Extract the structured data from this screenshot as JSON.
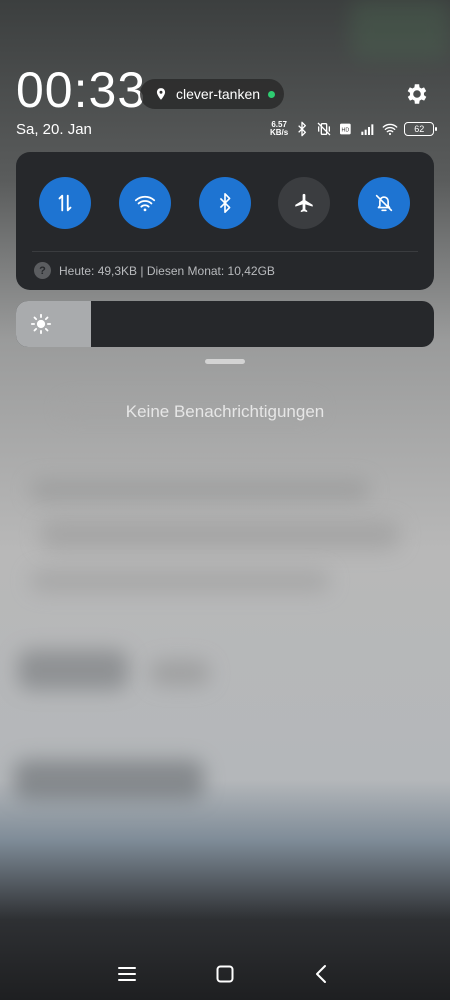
{
  "status": {
    "time": "00:33",
    "date": "Sa, 20. Jan",
    "network_speed_value": "6.57",
    "network_speed_unit": "KB/s",
    "battery": "62"
  },
  "location_chip": {
    "label": "clever-tanken",
    "active_color": "#2ecc71"
  },
  "quick_settings": {
    "tiles": [
      {
        "name": "mobile-data",
        "icon": "data-arrows-icon",
        "active": true
      },
      {
        "name": "wifi",
        "icon": "wifi-icon",
        "active": true
      },
      {
        "name": "bluetooth",
        "icon": "bluetooth-icon",
        "active": true
      },
      {
        "name": "airplane-mode",
        "icon": "airplane-icon",
        "active": false
      },
      {
        "name": "silent-mode",
        "icon": "bell-off-icon",
        "active": true
      }
    ],
    "data_usage": "Heute: 49,3KB | Diesen Monat: 10,42GB",
    "accent_color": "#1e74d2"
  },
  "brightness": {
    "level": 0.18
  },
  "notifications": {
    "empty_text": "Keine Benachrichtigungen"
  }
}
